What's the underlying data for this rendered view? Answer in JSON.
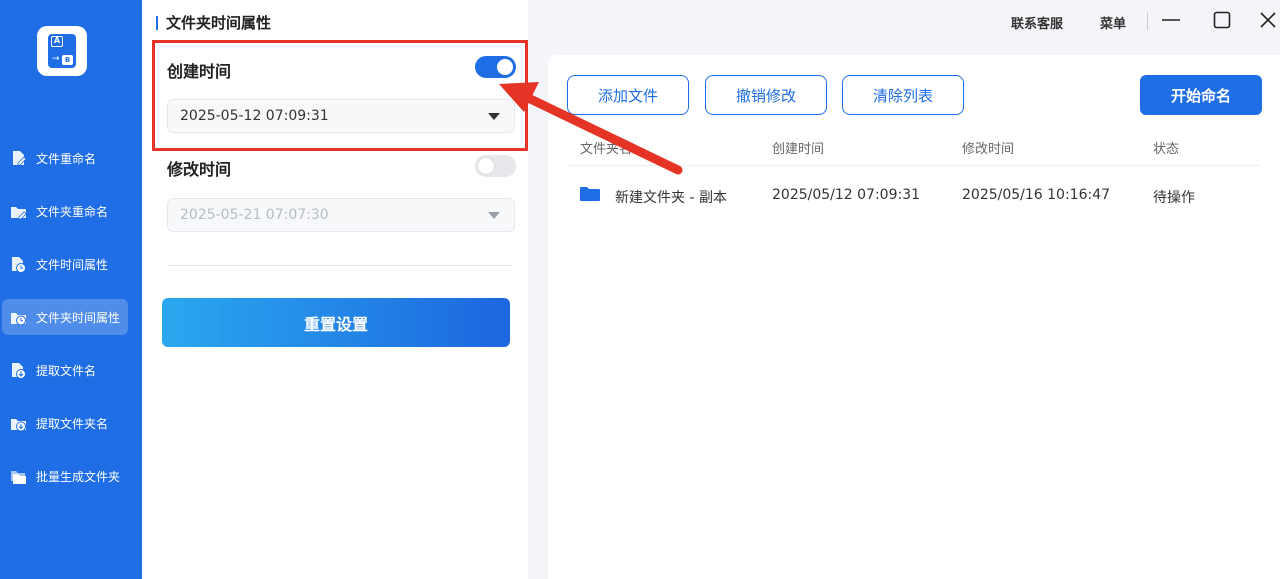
{
  "sidebar": {
    "items": [
      {
        "label": "文件重命名",
        "icon": "file-edit-icon"
      },
      {
        "label": "文件夹重命名",
        "icon": "folder-edit-icon"
      },
      {
        "label": "文件时间属性",
        "icon": "file-clock-icon"
      },
      {
        "label": "文件夹时间属性",
        "icon": "folder-clock-icon",
        "active": true
      },
      {
        "label": "提取文件名",
        "icon": "file-extract-icon"
      },
      {
        "label": "提取文件夹名",
        "icon": "folder-extract-icon"
      },
      {
        "label": "批量生成文件夹",
        "icon": "folders-icon"
      }
    ]
  },
  "settings": {
    "title": "文件夹时间属性",
    "created": {
      "label": "创建时间",
      "enabled": true,
      "value": "2025-05-12 07:09:31"
    },
    "modified": {
      "label": "修改时间",
      "enabled": false,
      "value": "2025-05-21 07:07:30"
    },
    "reset_label": "重置设置"
  },
  "topbar": {
    "support": "联系客服",
    "menu": "菜单"
  },
  "toolbar": {
    "add": "添加文件",
    "undo": "撤销修改",
    "clear": "清除列表",
    "start": "开始命名"
  },
  "table": {
    "headers": [
      "文件夹名",
      "创建时间",
      "修改时间",
      "状态"
    ],
    "rows": [
      {
        "name": "新建文件夹 - 副本",
        "created": "2025/05/12 07:09:31",
        "modified": "2025/05/16 10:16:47",
        "status": "待操作"
      }
    ]
  },
  "colors": {
    "accent": "#1f6ee6",
    "highlight": "#e53325"
  }
}
